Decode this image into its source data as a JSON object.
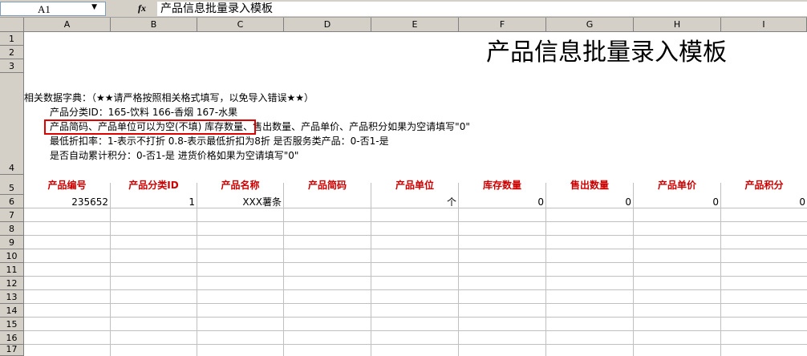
{
  "formula_bar": {
    "name_box": "A1",
    "fx_label": "fx",
    "content": "产品信息批量录入模板"
  },
  "columns": [
    "A",
    "B",
    "C",
    "D",
    "E",
    "F",
    "G",
    "H",
    "I"
  ],
  "rows": [
    "1",
    "2",
    "3",
    "4",
    "5",
    "6",
    "7",
    "8",
    "9",
    "10",
    "11",
    "12",
    "13",
    "14",
    "15",
    "16",
    "17"
  ],
  "title": "产品信息批量录入模板",
  "notes": [
    "相关数据字典：（★★请严格按照相关格式填写，以免导入错误★★）",
    "产品分类ID：165-饮料  166-香烟  167-水果",
    "产品简码、产品单位可以为空(不填)   库存数量、售出数量、产品单价、产品积分如果为空请填写\"0\"",
    "最低折扣率：1-表示不打折 0.8-表示最低折扣为8折  是否服务类产品：0-否1-是",
    "是否自动累计积分：0-否1-是   进货价格如果为空请填写\"0\""
  ],
  "headers": [
    "产品编号",
    "产品分类ID",
    "产品名称",
    "产品简码",
    "产品单位",
    "库存数量",
    "售出数量",
    "产品单价",
    "产品积分"
  ],
  "row6": [
    "235652",
    "1",
    "XXX薯条",
    "",
    "个",
    "0",
    "0",
    "0",
    "0"
  ]
}
